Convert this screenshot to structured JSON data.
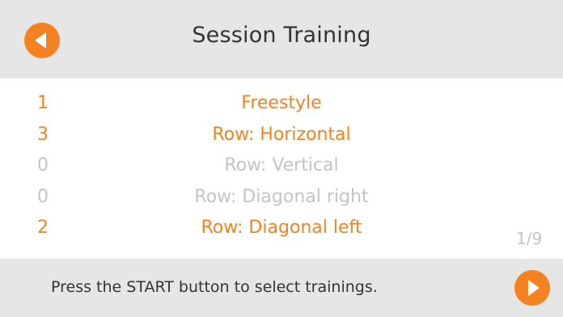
{
  "header": {
    "title": "Session Training",
    "back_icon": "back-arrow-icon"
  },
  "trainings": [
    {
      "count": "1",
      "name": "Freestyle",
      "state": "active"
    },
    {
      "count": "3",
      "name": "Row: Horizontal",
      "state": "active"
    },
    {
      "count": "0",
      "name": "Row: Vertical",
      "state": "inactive"
    },
    {
      "count": "0",
      "name": "Row: Diagonal right",
      "state": "inactive"
    },
    {
      "count": "2",
      "name": "Row: Diagonal left",
      "state": "active"
    }
  ],
  "pagination": {
    "indicator": "1/9"
  },
  "footer": {
    "hint": "Press the START button to select trainings.",
    "next_icon": "next-arrow-icon"
  },
  "colors": {
    "accent": "#f58220",
    "inactive": "#c4c4c4",
    "bar_background": "#e6e6e6",
    "text": "#333333"
  }
}
